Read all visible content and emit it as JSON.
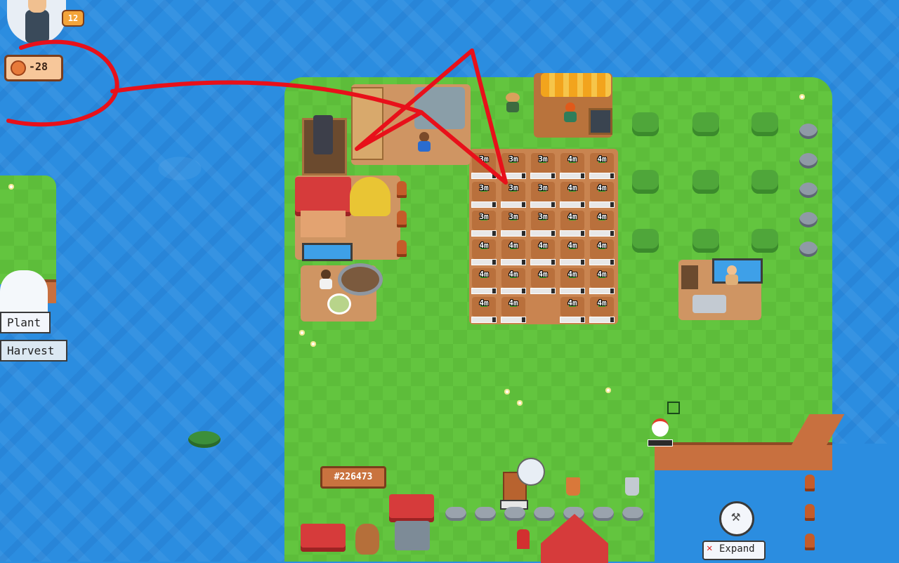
{
  "player": {
    "level": "12",
    "coins": "-28"
  },
  "menu": {
    "plant": "Plant",
    "harvest": "Harvest"
  },
  "farm": {
    "id": "#226473",
    "expand": "Expand"
  },
  "plots": {
    "rows": [
      [
        "3m",
        "3m",
        "3m",
        "4m",
        "4m"
      ],
      [
        "3m",
        "3m",
        "3m",
        "4m",
        "4m"
      ],
      [
        "3m",
        "3m",
        "3m",
        "4m",
        "4m"
      ],
      [
        "4m",
        "4m",
        "4m",
        "4m",
        "4m"
      ],
      [
        "4m",
        "4m",
        "4m",
        "4m",
        "4m"
      ],
      [
        "4m",
        "4m",
        "",
        "4m",
        "4m"
      ]
    ]
  },
  "colors": {
    "annotation": "#e8101a",
    "grass": "#63c53f",
    "water": "#2b8de0",
    "soil": "#b9703c"
  },
  "icons": {
    "coin": "coin-icon",
    "hammer": "hammer-icon",
    "close": "close-icon"
  }
}
